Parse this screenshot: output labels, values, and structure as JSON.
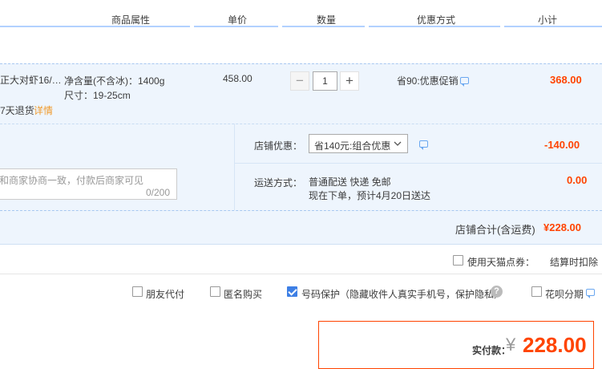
{
  "header": {
    "attr": "商品属性",
    "price": "单价",
    "qty": "数量",
    "promo": "优惠方式",
    "subtotal": "小计"
  },
  "item": {
    "name": "正大对虾16/…",
    "net_weight": "净含量(不含冰)：1400g",
    "size": "尺寸：19-25cm",
    "return_policy": "7天退货",
    "detail_link": "详情",
    "unit_price": "458.00",
    "quantity": "1",
    "promo": "省90:优惠促销",
    "subtotal": "368.00",
    "minus": "−",
    "plus": "+"
  },
  "shop": {
    "discount_label": "店铺优惠：",
    "discount_select": "省140元:组合优惠",
    "discount_amount": "-140.00",
    "note_placeholder": "和商家协商一致，付款后商家可见",
    "note_counter": "0/200",
    "shipping_label": "运送方式：",
    "shipping_method": "普通配送 快递 免邮",
    "shipping_eta": "现在下单，预计4月20日送达",
    "shipping_fee": "0.00",
    "total_label": "店铺合计(含运费)",
    "total_value": "¥228.00"
  },
  "points": {
    "label": "使用天猫点券：",
    "right_text": "结算时扣除"
  },
  "options": {
    "friend_pay": "朋友代付",
    "anonymous": "匿名购买",
    "number_protect": "号码保护（隐藏收件人真实手机号，保护隐私）",
    "huabei": "花呗分期",
    "help": "?"
  },
  "payment": {
    "label": "实付款：",
    "currency": "¥",
    "amount": "228.00"
  },
  "colors": {
    "accent": "#ff4400",
    "header_line": "#b2d1ff",
    "row_bg": "#eef5fd",
    "checkbox_on": "#3d7fe5"
  }
}
